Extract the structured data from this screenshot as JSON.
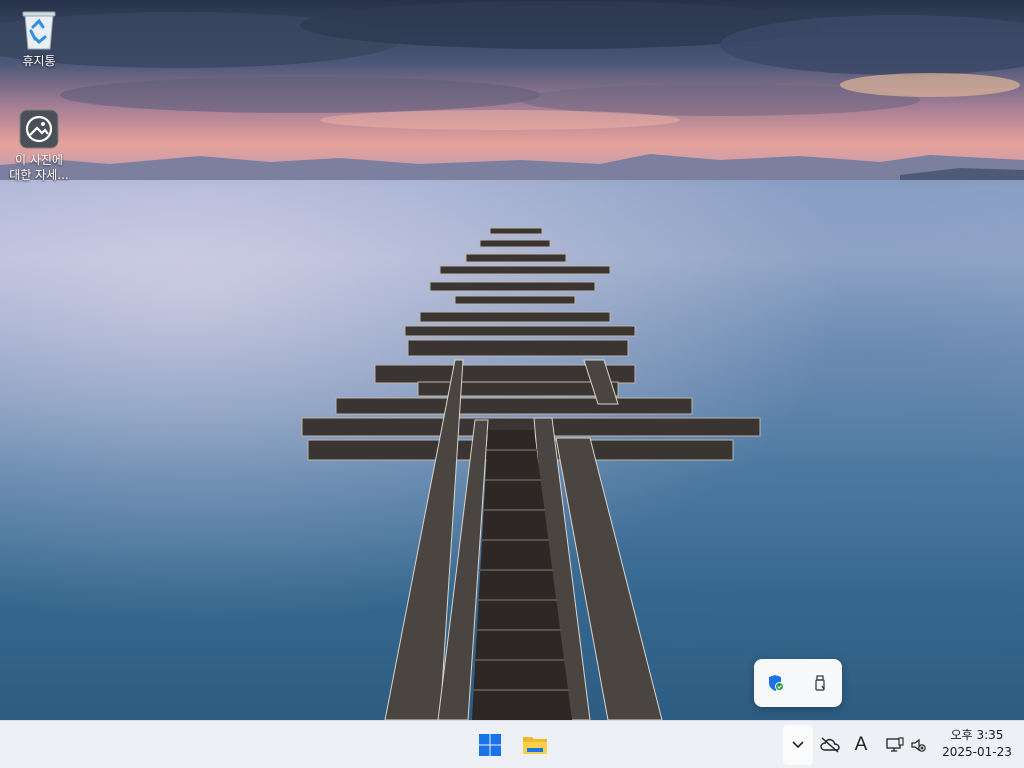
{
  "desktop": {
    "icons": [
      {
        "label": "휴지통",
        "icon": "recycle-bin-icon"
      },
      {
        "label": "이 사진에\n대한 자세...",
        "icon": "photo-info-icon"
      }
    ]
  },
  "tray_overflow": {
    "items": [
      {
        "icon": "windows-security-icon"
      },
      {
        "icon": "usb-device-icon"
      }
    ]
  },
  "taskbar": {
    "pinned": [
      {
        "icon": "start-windows-icon"
      },
      {
        "icon": "file-explorer-icon"
      }
    ],
    "system": {
      "show_hidden_icon": "chevron-up-icon",
      "onedrive_icon": "cloud-off-icon",
      "ime_label": "A",
      "network_icon": "network-icon",
      "volume_icon": "volume-muted-icon"
    },
    "clock": {
      "time": "오후 3:35",
      "date": "2025-01-23"
    }
  },
  "colors": {
    "taskbar_bg": "#edf0f4",
    "windows_blue": "#1a73e8",
    "folder_yellow": "#f3b82a"
  }
}
